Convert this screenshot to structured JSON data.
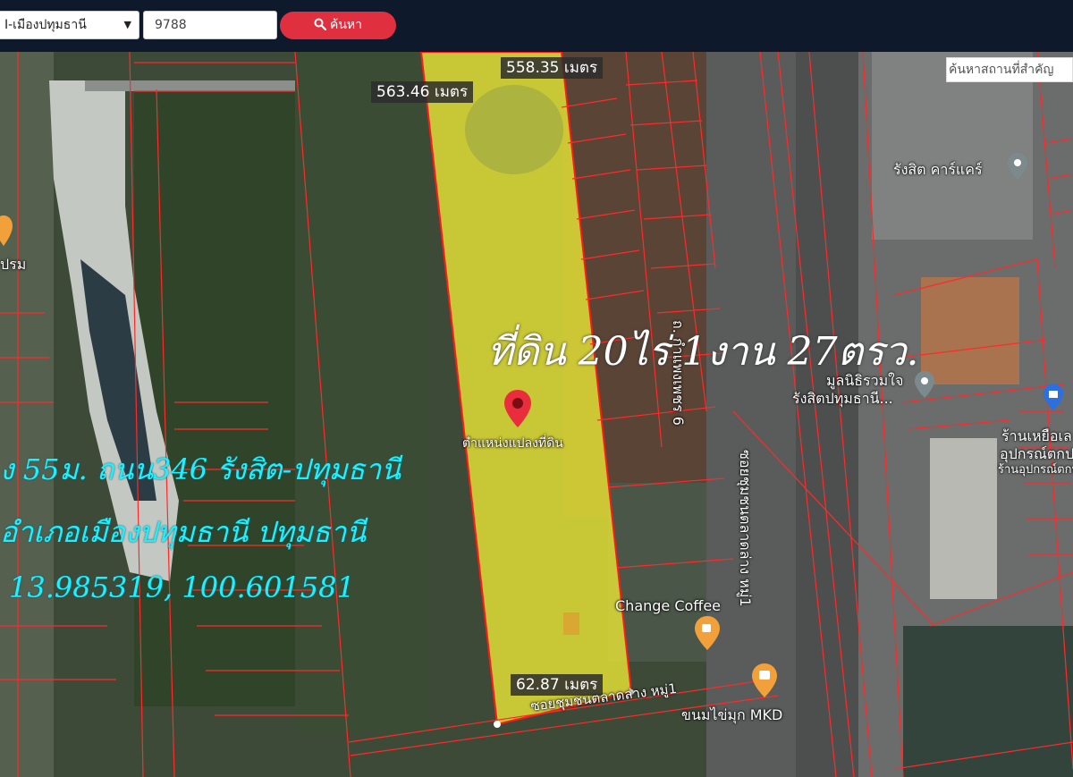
{
  "toolbar": {
    "district_value": "I-เมืองปทุมธานี",
    "parcel_value": "9788",
    "search_label": "ค้นหา"
  },
  "map": {
    "place_search_placeholder": "ค้นหาสถานที่สำคัญ",
    "measurements": {
      "top": "558.35 เมตร",
      "left": "563.46 เมตร",
      "bottom": "62.87 เมตร"
    },
    "pin_label": "ตำแหน่งแปลงที่ดิน",
    "poi": {
      "car_care": "รังสิต คาร์แคร์",
      "foundation_line1": "มูลนิธิรวมใจ",
      "foundation_line2": "รังสิตปทุมธานี...",
      "shop_line1": "ร้านเหยือเล",
      "shop_line2": "อุปกรณ์ตกปล",
      "shop_line3": "ร้านอุปกรณ์ตกปล",
      "cafe": "Change Coffee",
      "dessert": "ขนมไข่มุก MKD",
      "left_place": "ปรม"
    },
    "roads": {
      "main_road": "ถ. กำแพงเพชร 6",
      "soi_vertical": "ซอยชุมชนตลาดล่าง หมู่1",
      "soi_bottom": "ซอยชุมชนตลาดล่าง หมู่1"
    },
    "overlay": {
      "title": "ที่ดิน 20ไร่ 1งาน 27ตรว.",
      "line1": "ง 55ม. ถนน346 รังสิต-ปทุมธานี",
      "line2": "อำเภอเมืองปทุมธานี ปทุมธานี",
      "line3": "13.985319, 100.601581"
    }
  },
  "colors": {
    "parcel_fill": "#e7e336",
    "parcel_border": "#ff1a1a",
    "search_button": "#e0303f",
    "topbar": "#0e1a2b",
    "cyan_text": "#1ef0ff"
  }
}
